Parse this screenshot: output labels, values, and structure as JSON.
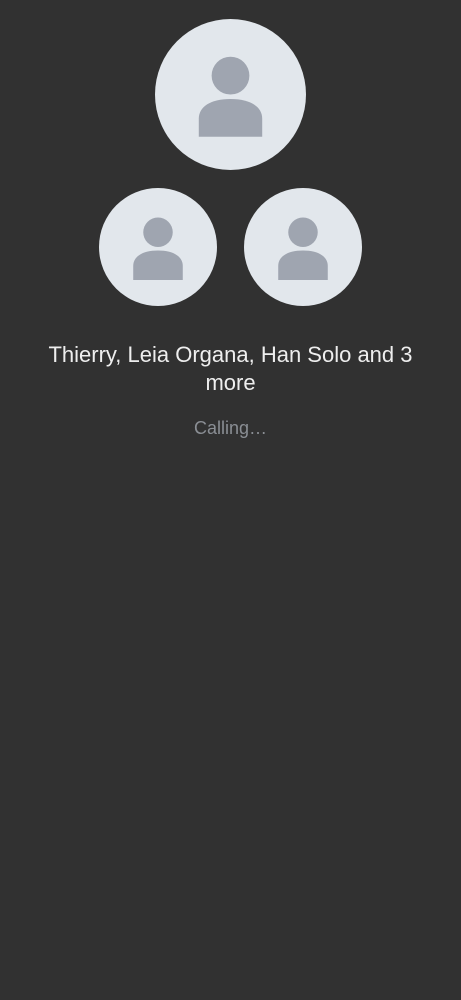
{
  "call": {
    "participants_label": "Thierry, Leia Organa, Han Solo and 3 more",
    "status": "Calling…"
  },
  "avatars": [
    {
      "name": "main-avatar",
      "icon": "person-icon"
    },
    {
      "name": "secondary-avatar-left",
      "icon": "person-icon"
    },
    {
      "name": "secondary-avatar-right",
      "icon": "person-icon"
    }
  ],
  "colors": {
    "background": "#313131",
    "avatar_bg": "#e2e7ec",
    "avatar_fg": "#9fa5b0",
    "primary_text": "#eeeeee",
    "secondary_text": "#8a8e94"
  }
}
